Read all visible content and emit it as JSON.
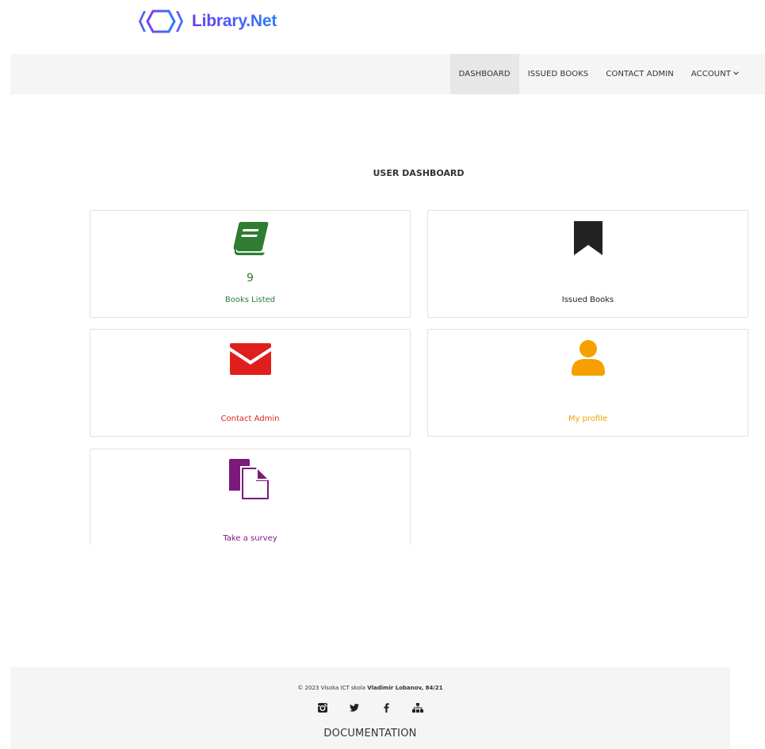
{
  "brand": {
    "name": "Library.Net"
  },
  "nav": {
    "items": [
      {
        "label": "DASHBOARD"
      },
      {
        "label": "ISSUED BOOKS"
      },
      {
        "label": "CONTACT ADMIN"
      },
      {
        "label": "ACCOUNT"
      }
    ],
    "active": "DASHBOARD"
  },
  "page": {
    "heading": "USER DASHBOARD"
  },
  "cards": [
    {
      "count": "9",
      "label": "Books Listed",
      "icon": "book-icon",
      "color": "#2e7d32"
    },
    {
      "label": "Issued Books",
      "icon": "bookmark-icon",
      "color": "#222222"
    },
    {
      "label": "Contact Admin",
      "icon": "envelope-icon",
      "color": "#e01e1e"
    },
    {
      "label": "My profile",
      "icon": "user-icon",
      "color": "#f5a000"
    },
    {
      "label": "Take a survey",
      "icon": "copy-icon",
      "color": "#7b1a7a"
    }
  ],
  "footer": {
    "copyright_prefix": "© 2023 Visoka ICT skola",
    "copyright_author": "Vladimir Lobanov, 84/21",
    "socials": [
      "instagram-icon",
      "twitter-icon",
      "facebook-icon",
      "sitemap-icon"
    ],
    "documentation": "DOCUMENTATION"
  }
}
